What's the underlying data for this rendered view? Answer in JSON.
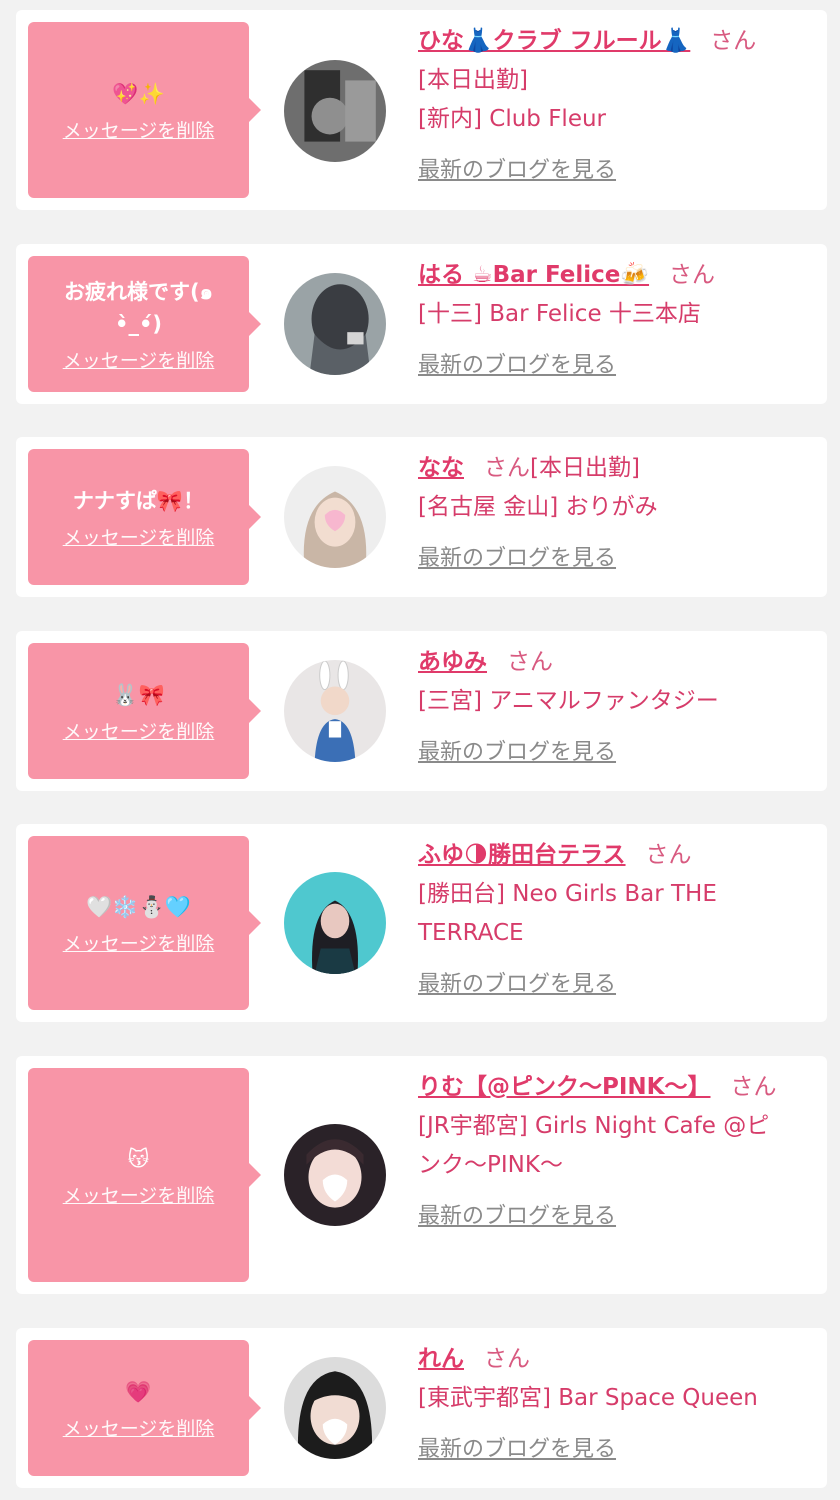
{
  "delete_label": "メッセージを削除",
  "blog_label": "最新のブログを見る",
  "san_label": "さん",
  "colors": {
    "bubble": "#f895a7",
    "name": "#e03a6a",
    "text": "#d63c6a",
    "link": "#8a8a8a",
    "background": "#f2f2f2"
  },
  "cards": [
    {
      "message": "💖✨",
      "name": "ひな👗クラブ フルール👗",
      "lines": [
        "[本日出勤]",
        "[新内] Club Fleur"
      ],
      "avatar": "avatar-photo"
    },
    {
      "message": "お疲れ様です(๑\n•̀_•́)",
      "name": "はる ☕Bar Felice🍻",
      "lines": [
        "[十三] Bar Felice 十三本店"
      ],
      "avatar": "avatar-photo"
    },
    {
      "message": "ナナすぱ🎀！",
      "name": "なな",
      "inline_status": "[本日出勤]",
      "lines": [
        "[名古屋 金山] おりがみ"
      ],
      "avatar": "avatar-photo"
    },
    {
      "message": "🐰🎀",
      "name": "あゆみ",
      "lines": [
        "[三宮] アニマルファンタジー"
      ],
      "avatar": "avatar-photo"
    },
    {
      "message": "🤍❄️⛄🩵",
      "name": "ふゆ🌗勝田台テラス",
      "lines": [
        "[勝田台] Neo Girls Bar THE",
        "TERRACE"
      ],
      "avatar": "avatar-photo"
    },
    {
      "message": "😽",
      "name": "りむ【@ピンク〜PINK〜】",
      "name_wrap": "ん",
      "lines": [
        "[JR宇都宮] Girls Night Cafe @ピ",
        "ンク〜PINK〜"
      ],
      "avatar": "avatar-photo"
    },
    {
      "message": "💗",
      "name": "れん",
      "lines": [
        "[東武宇都宮] Bar Space Queen"
      ],
      "avatar": "avatar-photo"
    }
  ]
}
